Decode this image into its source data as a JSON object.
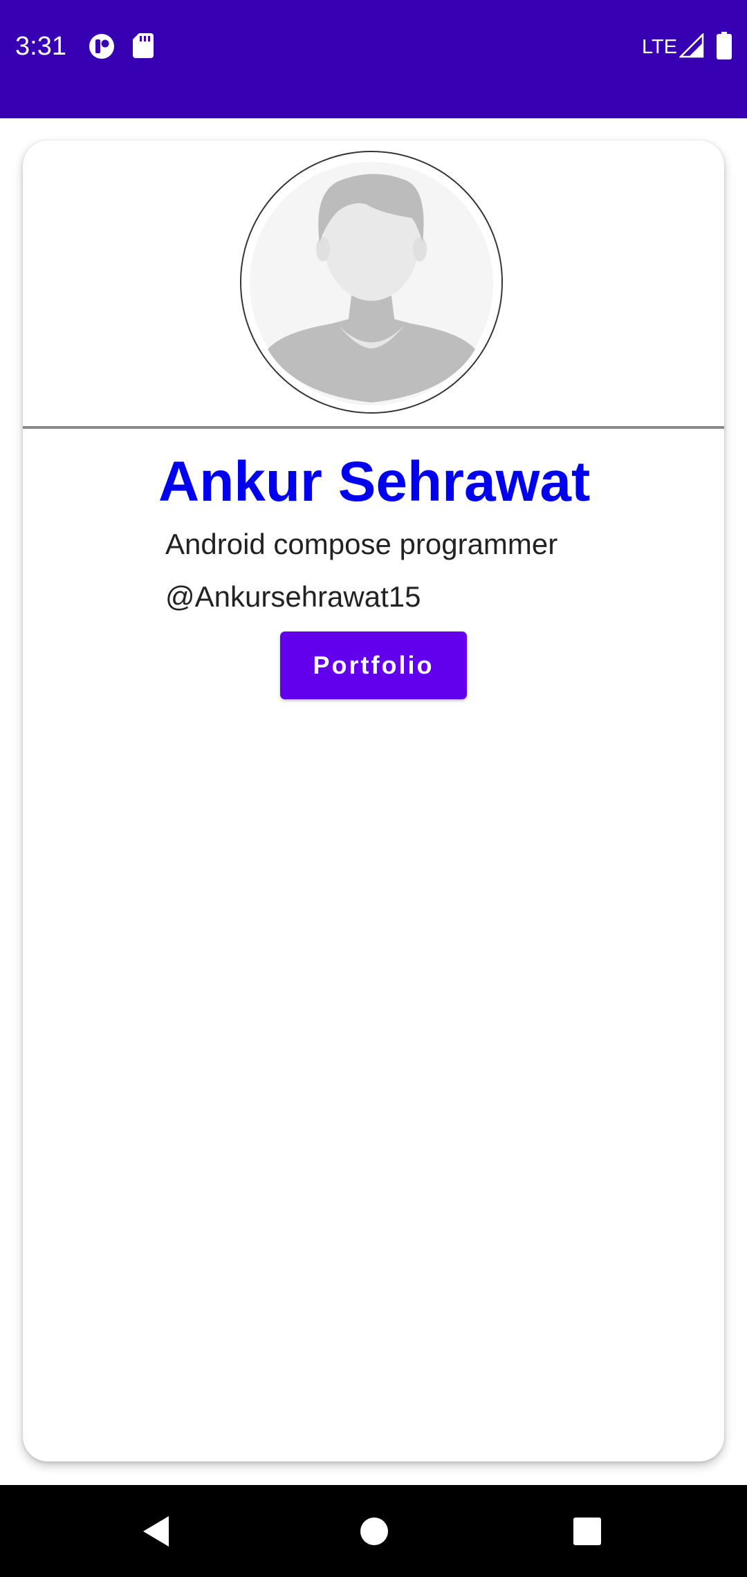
{
  "status_bar": {
    "time": "3:31",
    "network": "LTE",
    "color": "#3700b3",
    "icons": [
      "app-notification-icon",
      "sd-card-icon",
      "signal-icon",
      "battery-icon"
    ]
  },
  "profile": {
    "name": "Ankur Sehrawat",
    "role": "Android compose programmer",
    "handle": "@Ankursehrawat15",
    "name_color": "#0000ee"
  },
  "actions": {
    "portfolio_label": "Portfolio",
    "button_color": "#6200ee"
  },
  "nav_bar": {
    "icons": [
      "back-icon",
      "home-icon",
      "recents-icon"
    ]
  }
}
